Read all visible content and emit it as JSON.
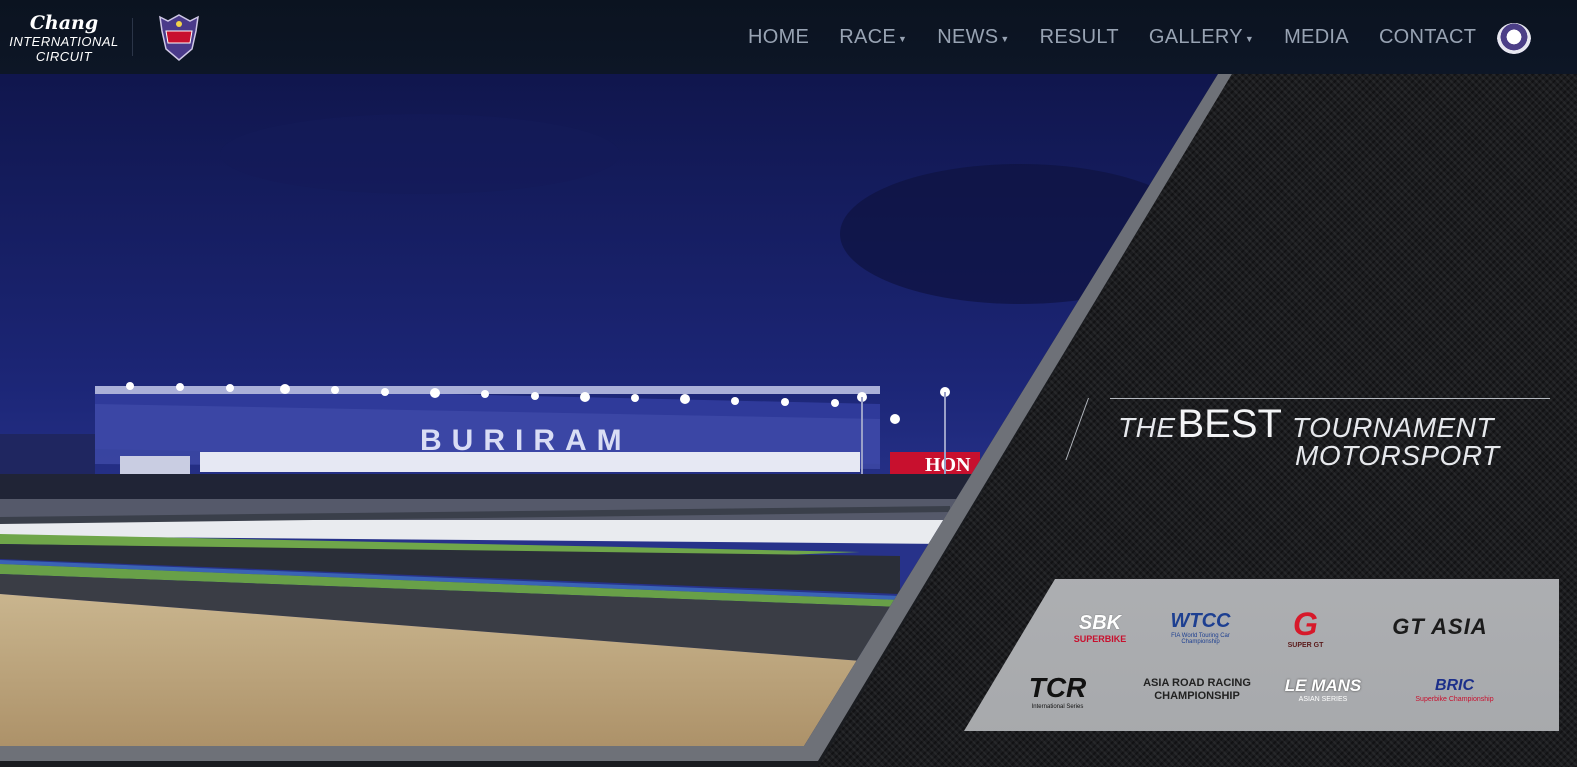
{
  "brand": {
    "line1": "Chang",
    "line2": "INTERNATIONAL",
    "line3": "CIRCUIT",
    "crest_text": "BURIRAM"
  },
  "nav": {
    "items": [
      {
        "label": "HOME",
        "dropdown": false
      },
      {
        "label": "RACE",
        "dropdown": true
      },
      {
        "label": "NEWS",
        "dropdown": true
      },
      {
        "label": "RESULT",
        "dropdown": false
      },
      {
        "label": "GALLERY",
        "dropdown": true
      },
      {
        "label": "MEDIA",
        "dropdown": false
      },
      {
        "label": "CONTACT",
        "dropdown": false
      }
    ],
    "language_icon": "thai-flag-icon"
  },
  "hero": {
    "stadium_text": "BURIRAM",
    "banner_text": "HON",
    "tagline": {
      "the": "THE",
      "best": "BEST",
      "tournament": "TOURNAMENT",
      "motorsport": "MOTORSPORT"
    }
  },
  "sponsors": [
    {
      "name": "SBK",
      "sub": "SUPERBIKE",
      "color": "#c8102e"
    },
    {
      "name": "WTCC",
      "sub": "FIA World Touring Car Championship",
      "color": "#1d3f91"
    },
    {
      "name": "G",
      "sub": "SUPER GT",
      "color": "#d7192a"
    },
    {
      "name": "GT ASIA",
      "sub": "",
      "color": "#1b1b1b"
    },
    {
      "name": "TCR",
      "sub": "International Series",
      "color": "#111111"
    },
    {
      "name": "ASIA ROAD RACING CHAMPIONSHIP",
      "sub": "",
      "color": "#222222"
    },
    {
      "name": "LE MANS",
      "sub": "ASIAN SERIES",
      "color": "#ffffff"
    },
    {
      "name": "BRIC",
      "sub": "Superbike Championship",
      "color": "#1c2f8a"
    }
  ],
  "colors": {
    "nav_bg": "#0b1320",
    "nav_text": "#98a3b3",
    "sky": "#1b2470",
    "accent_red": "#c8102e"
  }
}
